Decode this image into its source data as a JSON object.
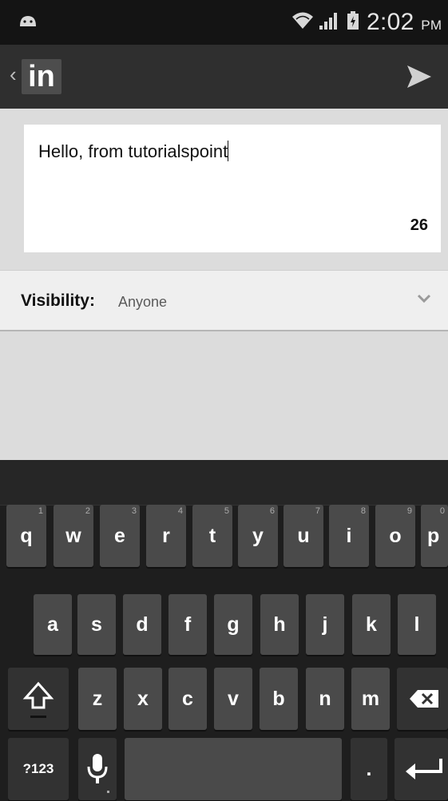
{
  "status_bar": {
    "time": "2:02",
    "ampm": "PM",
    "icons": [
      "android-icon",
      "wifi-icon",
      "signal-icon",
      "battery-icon"
    ]
  },
  "action_bar": {
    "back_glyph": "‹",
    "logo_text": "in",
    "send_icon": "send-icon"
  },
  "compose": {
    "message": "Hello, from tutorialspoint",
    "char_count": "26"
  },
  "visibility": {
    "label": "Visibility:",
    "value": "Anyone"
  },
  "keyboard": {
    "row1": [
      {
        "label": "q",
        "hint": "1"
      },
      {
        "label": "w",
        "hint": "2"
      },
      {
        "label": "e",
        "hint": "3"
      },
      {
        "label": "r",
        "hint": "4"
      },
      {
        "label": "t",
        "hint": "5"
      },
      {
        "label": "y",
        "hint": "6"
      },
      {
        "label": "u",
        "hint": "7"
      },
      {
        "label": "i",
        "hint": "8"
      },
      {
        "label": "o",
        "hint": "9"
      },
      {
        "label": "p",
        "hint": "0"
      }
    ],
    "row2": [
      "a",
      "s",
      "d",
      "f",
      "g",
      "h",
      "j",
      "k",
      "l"
    ],
    "row3": [
      "z",
      "x",
      "c",
      "v",
      "b",
      "n",
      "m"
    ],
    "symbols_label": "?123",
    "period_label": "."
  },
  "colors": {
    "status_bar": "#141414",
    "action_bar": "#2f2f2f",
    "content_bg": "#dcdcdc",
    "key": "#4a4a4a"
  }
}
